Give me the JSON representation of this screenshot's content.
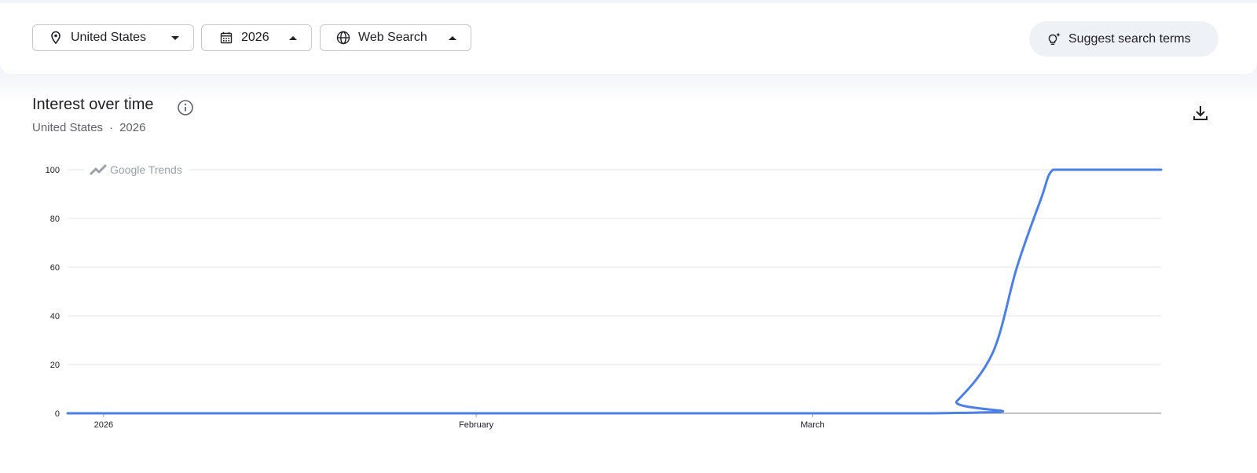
{
  "filters": {
    "location": {
      "label": "United States",
      "icon": "location-pin-icon"
    },
    "time": {
      "label": "2026",
      "icon": "calendar-icon"
    },
    "property": {
      "label": "Web Search",
      "icon": "globe-icon"
    }
  },
  "suggest_button": {
    "label": "Suggest search terms",
    "icon": "lightbulb-sparkle-icon"
  },
  "section": {
    "title": "Interest over time",
    "subtitle_location": "United States",
    "subtitle_separator": "·",
    "subtitle_period": "2026"
  },
  "watermark": "Google Trends",
  "colors": {
    "line": "#4c80e4",
    "grid": "#e6e6e6",
    "baseline": "#9e9e9e"
  },
  "chart_data": {
    "type": "line",
    "title": "Interest over time",
    "xlabel": "",
    "ylabel": "",
    "ylim": [
      0,
      100
    ],
    "yticks": [
      0,
      20,
      40,
      60,
      80,
      100
    ],
    "xticks": [
      {
        "label": "2026",
        "date": "2026-01-01"
      },
      {
        "label": "February",
        "date": "2026-02-01"
      },
      {
        "label": "March",
        "date": "2026-03-01"
      }
    ],
    "grid": true,
    "legend": "none",
    "series": [
      {
        "x": [
          "2025-12-29",
          "2026-03-11",
          "2026-03-13",
          "2026-03-16",
          "2026-03-18",
          "2026-03-20",
          "2026-03-21",
          "2026-03-23",
          "2026-03-30"
        ],
        "y": [
          0,
          0,
          5,
          25,
          60,
          88,
          100,
          100,
          100
        ]
      }
    ]
  }
}
